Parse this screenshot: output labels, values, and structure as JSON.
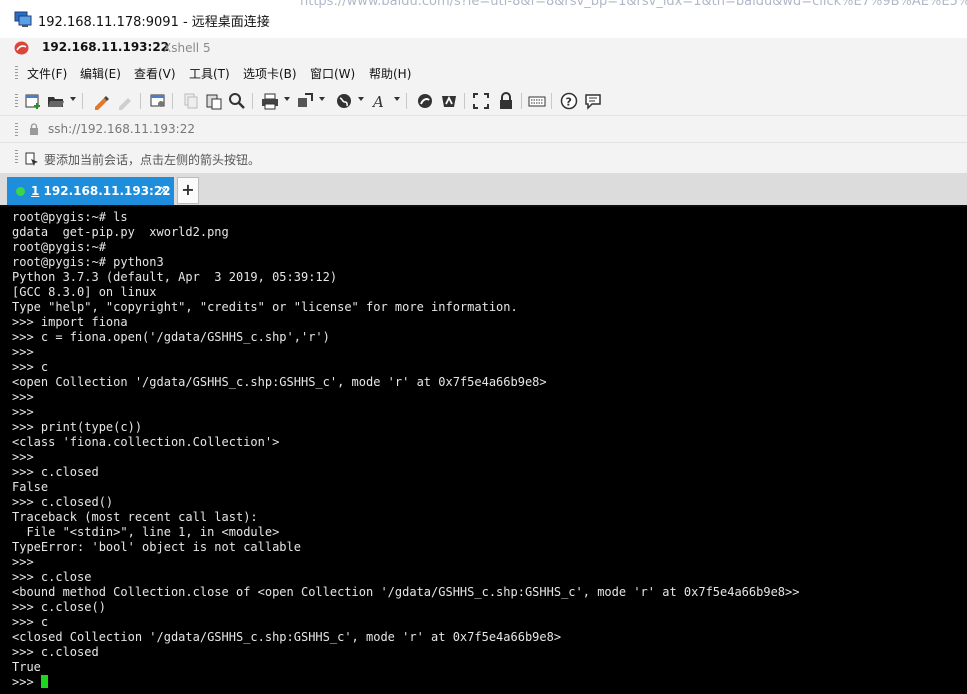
{
  "rdp": {
    "ghost_url": "https://www.baidu.com/s?ie=utf-8&f=8&rsv_bp=1&rsv_idx=1&tn=baidu&wd=click%E7%9B%AE%E5%BD%95&oq=click%E7%9B%AE",
    "title": "192.168.11.178:9091 - 远程桌面连接"
  },
  "xshell": {
    "host": "192.168.11.193:22",
    "app": "Xshell 5"
  },
  "menu": {
    "items": [
      "文件(F)",
      "编辑(E)",
      "查看(V)",
      "工具(T)",
      "选项卡(B)",
      "窗口(W)",
      "帮助(H)"
    ]
  },
  "toolbar": {
    "icons": [
      "new-session-icon",
      "open-folder-icon",
      "reconnect-icon",
      "disconnect-icon",
      "properties-icon",
      "copy-icon",
      "paste-icon",
      "find-icon",
      "print-icon",
      "transfer-icon",
      "globe-icon",
      "font-icon",
      "xftp-icon",
      "xmanager-icon",
      "fullscreen-icon",
      "lock-icon",
      "keyboard-icon",
      "help-icon",
      "chat-icon"
    ]
  },
  "address": {
    "text": "ssh://192.168.11.193:22"
  },
  "tip": {
    "text": "要添加当前会话，点击左侧的箭头按钮。"
  },
  "tabs": {
    "active_num": "1",
    "active_label": " 192.168.11.193:22",
    "close": "×",
    "add": "+"
  },
  "colors": {
    "tab_active": "#1e8ddb",
    "terminal_bg": "#000000",
    "terminal_fg": "#e6e6e6",
    "cursor": "#1ed61e",
    "status_dot": "#3ad64a"
  },
  "terminal": {
    "lines": [
      "root@pygis:~# ls",
      "gdata  get-pip.py  xworld2.png",
      "root@pygis:~#",
      "root@pygis:~# python3",
      "Python 3.7.3 (default, Apr  3 2019, 05:39:12)",
      "[GCC 8.3.0] on linux",
      "Type \"help\", \"copyright\", \"credits\" or \"license\" for more information.",
      ">>> import fiona",
      ">>> c = fiona.open('/gdata/GSHHS_c.shp','r')",
      ">>>",
      ">>> c",
      "<open Collection '/gdata/GSHHS_c.shp:GSHHS_c', mode 'r' at 0x7f5e4a66b9e8>",
      ">>>",
      ">>>",
      ">>> print(type(c))",
      "<class 'fiona.collection.Collection'>",
      ">>>",
      ">>> c.closed",
      "False",
      ">>> c.closed()",
      "Traceback (most recent call last):",
      "  File \"<stdin>\", line 1, in <module>",
      "TypeError: 'bool' object is not callable",
      ">>>",
      ">>> c.close",
      "<bound method Collection.close of <open Collection '/gdata/GSHHS_c.shp:GSHHS_c', mode 'r' at 0x7f5e4a66b9e8>>",
      ">>> c.close()",
      ">>> c",
      "<closed Collection '/gdata/GSHHS_c.shp:GSHHS_c', mode 'r' at 0x7f5e4a66b9e8>",
      ">>> c.closed",
      "True"
    ],
    "prompt": ">>> "
  }
}
